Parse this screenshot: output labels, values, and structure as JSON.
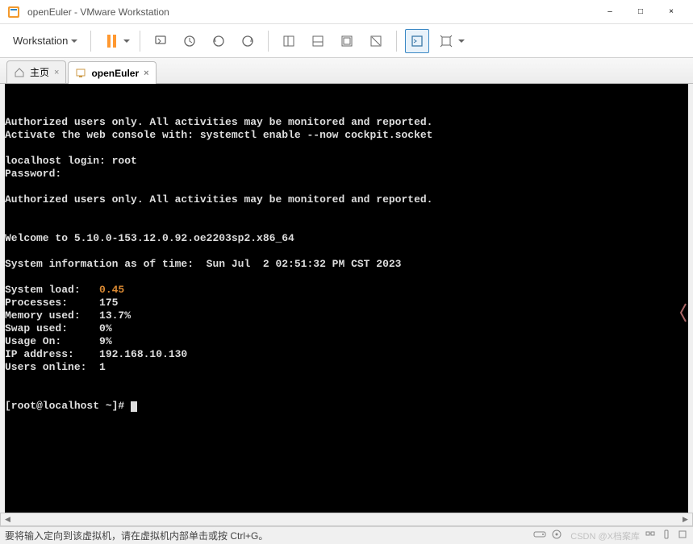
{
  "window": {
    "title": "openEuler - VMware Workstation",
    "minimize": "–",
    "maximize": "□",
    "close": "×"
  },
  "toolbar": {
    "menu_label": "Workstation"
  },
  "tabs": {
    "home": "主页",
    "vm": "openEuler"
  },
  "terminal": {
    "line1": "Authorized users only. All activities may be monitored and reported.",
    "line2": "Activate the web console with: systemctl enable --now cockpit.socket",
    "login_prompt": "localhost login: root",
    "password_prompt": "Password:",
    "line3": "Authorized users only. All activities may be monitored and reported.",
    "welcome": "Welcome to 5.10.0-153.12.0.92.oe2203sp2.x86_64",
    "sysinfo_header": "System information as of time:  Sun Jul  2 02:51:32 PM CST 2023",
    "stats": [
      {
        "label": "System load:   ",
        "value": "0.45",
        "orange": true
      },
      {
        "label": "Processes:     ",
        "value": "175"
      },
      {
        "label": "Memory used:   ",
        "value": "13.7%"
      },
      {
        "label": "Swap used:     ",
        "value": "0%"
      },
      {
        "label": "Usage On:      ",
        "value": "9%"
      },
      {
        "label": "IP address:    ",
        "value": "192.168.10.130"
      },
      {
        "label": "Users online:  ",
        "value": "1"
      }
    ],
    "prompt": "[root@localhost ~]# "
  },
  "statusbar": {
    "text": "要将输入定向到该虚拟机，请在虚拟机内部单击或按 Ctrl+G。",
    "watermark": "CSDN @X档案库"
  }
}
